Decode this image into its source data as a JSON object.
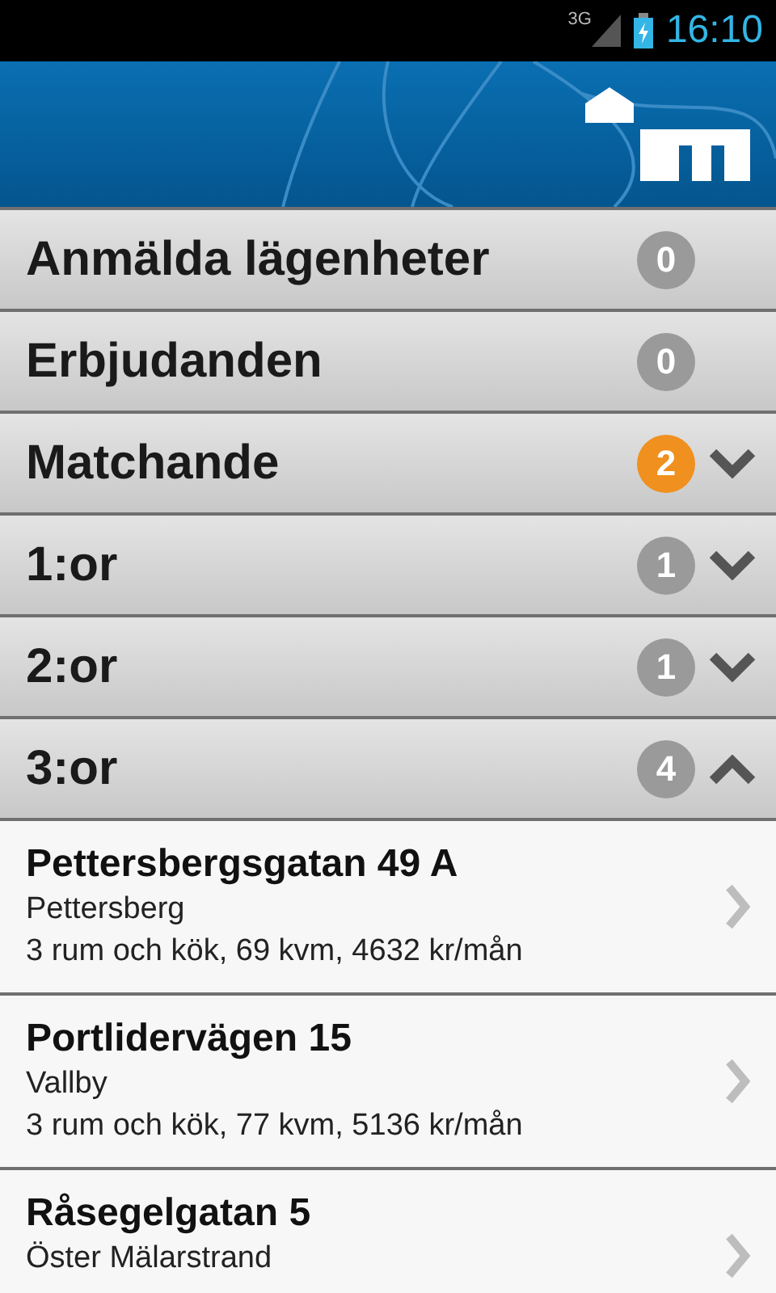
{
  "status_bar": {
    "network": "3G",
    "time": "16:10"
  },
  "groups": [
    {
      "title": "Anmälda lägenheter",
      "count": "0",
      "color": "#9a9a9a"
    },
    {
      "title": "Erbjudanden",
      "count": "0",
      "color": "#9a9a9a"
    },
    {
      "title": "Matchande",
      "count": "2",
      "color": "#f0901e",
      "expanded": false
    },
    {
      "title": "1:or",
      "count": "1",
      "color": "#9a9a9a",
      "expanded": false
    },
    {
      "title": "2:or",
      "count": "1",
      "color": "#9a9a9a",
      "expanded": false
    },
    {
      "title": "3:or",
      "count": "4",
      "color": "#9a9a9a",
      "expanded": true
    }
  ],
  "listings": [
    {
      "address": "Pettersbergsgatan 49 A",
      "area": "Pettersberg",
      "details": "3 rum och kök, 69 kvm, 4632 kr/mån"
    },
    {
      "address": "Portlidervägen 15",
      "area": "Vallby",
      "details": "3 rum och kök, 77 kvm, 5136 kr/mån"
    },
    {
      "address": "Råsegelgatan 5",
      "area": "Öster Mälarstrand"
    }
  ]
}
